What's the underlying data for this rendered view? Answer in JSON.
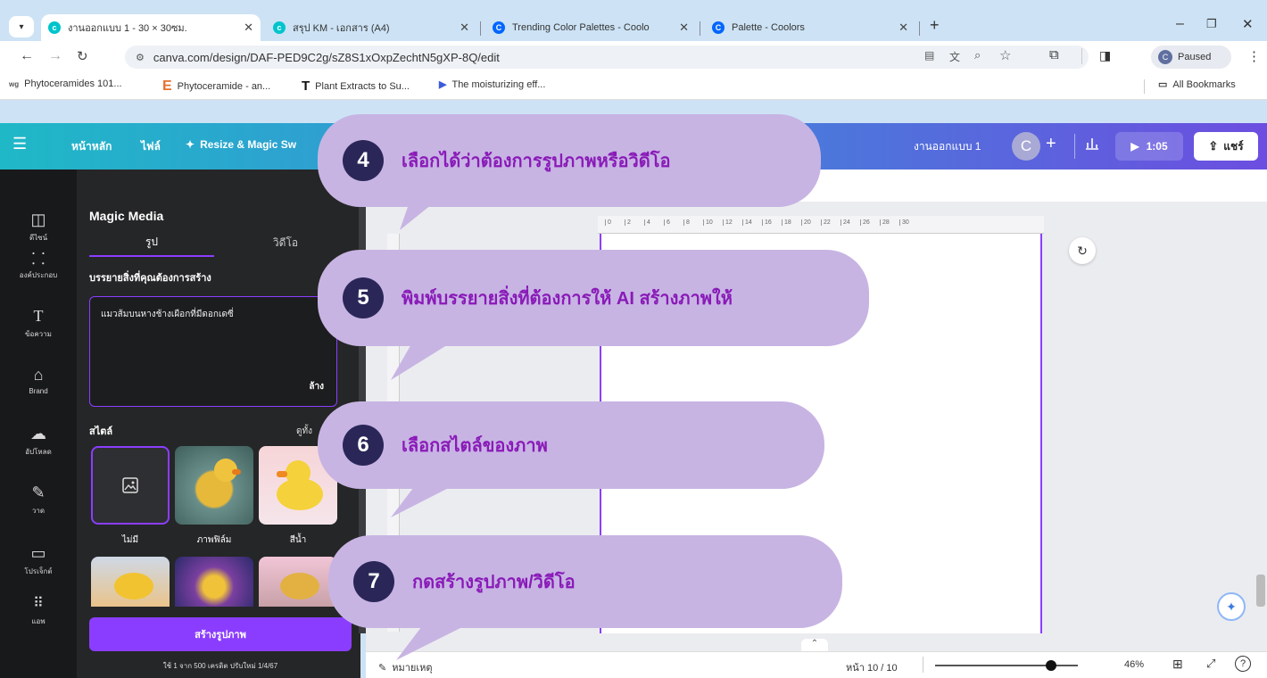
{
  "browser": {
    "tabs": [
      {
        "title": "งานออกแบบ 1 - 30 × 30ซม.",
        "active": true,
        "icon": "canva-icon",
        "color": "#00c4cc"
      },
      {
        "title": "สรุป KM - เอกสาร (A4)",
        "active": false,
        "icon": "canva-icon",
        "color": "#00c4cc"
      },
      {
        "title": "Trending Color Palettes - Coolo",
        "active": false,
        "icon": "coolors-icon",
        "color": "#0066ff"
      },
      {
        "title": "Palette - Coolors",
        "active": false,
        "icon": "coolors-icon",
        "color": "#0066ff"
      }
    ],
    "new_tab": "+",
    "url": "canva.com/design/DAF-PED9C2g/sZ8S1xOxpZechtN5gXP-8Q/edit",
    "profile": "Paused",
    "bookmarks": [
      "Phytoceramides 101...",
      "Phytoceramide - an...",
      "Plant Extracts to Su...",
      "The moisturizing eff..."
    ],
    "bookmark_icons": [
      "wg",
      "E",
      "T",
      "▶"
    ],
    "all_bookmarks": "All Bookmarks"
  },
  "canva": {
    "menu": [
      "หน้าหลัก",
      "ไฟล์",
      "Resize & Magic Sw"
    ],
    "design_title": "งานออกแบบ 1",
    "avatar": "C",
    "play_time": "1:05",
    "share": "แชร์",
    "rail": [
      "ดีไซน์",
      "องค์ประกอบ",
      "ข้อความ",
      "Brand",
      "อัปโหลด",
      "วาด",
      "โปรเจ็กต์",
      "แอพ"
    ],
    "panel": {
      "title": "Magic Media",
      "tabs": [
        "รูป",
        "วิดีโอ"
      ],
      "prompt_label": "บรรยายสิ่งที่คุณต้องการสร้าง",
      "prompt_value": "แมวส้มบนหางช้างเผือกที่มีดอกเดซี่",
      "clear": "ล้าง",
      "style_label": "สไตล์",
      "see_all": "ดูทั้ง",
      "styles": [
        "ไม่มี",
        "ภาพฟิล์ม",
        "สีน้ำ"
      ],
      "create_button": "สร้างรูปภาพ",
      "credits": "ใช้ 1 จาก 500 เครดิต ปรับใหม่ 1/4/67"
    },
    "ruler": [
      "0",
      "2",
      "4",
      "6",
      "8",
      "10",
      "12",
      "14",
      "16",
      "18",
      "20",
      "22",
      "24",
      "26",
      "28",
      "30"
    ],
    "footer": {
      "notes": "หมายเหตุ",
      "page": "หน้า 10 / 10",
      "zoom": "46%",
      "zoom_level": 0.46
    }
  },
  "callouts": [
    {
      "num": "4",
      "text": "เลือกได้ว่าต้องการรูปภาพหรือวิดีโอ"
    },
    {
      "num": "5",
      "text": "พิมพ์บรรยายสิ่งที่ต้องการให้ AI สร้างภาพให้"
    },
    {
      "num": "6",
      "text": "เลือกสไตล์ของภาพ"
    },
    {
      "num": "7",
      "text": "กดสร้างรูปภาพ/วิดีโอ"
    }
  ],
  "colors": {
    "accent": "#8b3dff",
    "callout_bg": "#c7b4e3",
    "callout_text": "#8a1ab8",
    "badge": "#2a2758"
  }
}
